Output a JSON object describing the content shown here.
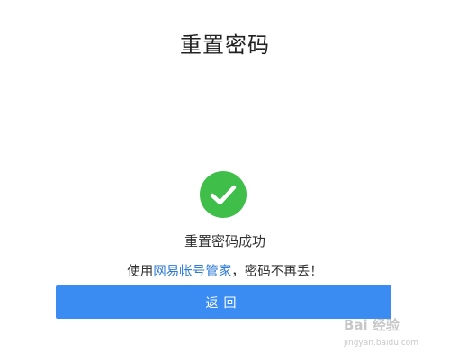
{
  "header": {
    "title": "重置密码"
  },
  "status": {
    "text": "重置密码成功",
    "icon": "check-circle-icon",
    "icon_color": "#3fbf4a"
  },
  "hint": {
    "prefix": "使用",
    "link_text": "网易帐号管家",
    "suffix": "，密码不再丢！",
    "link_color": "#2e7bd6"
  },
  "back_button": {
    "label": "返回",
    "color": "#3b8cf2"
  },
  "watermark": {
    "main": "Bai 经验",
    "sub": "jingyan.baidu.com"
  }
}
